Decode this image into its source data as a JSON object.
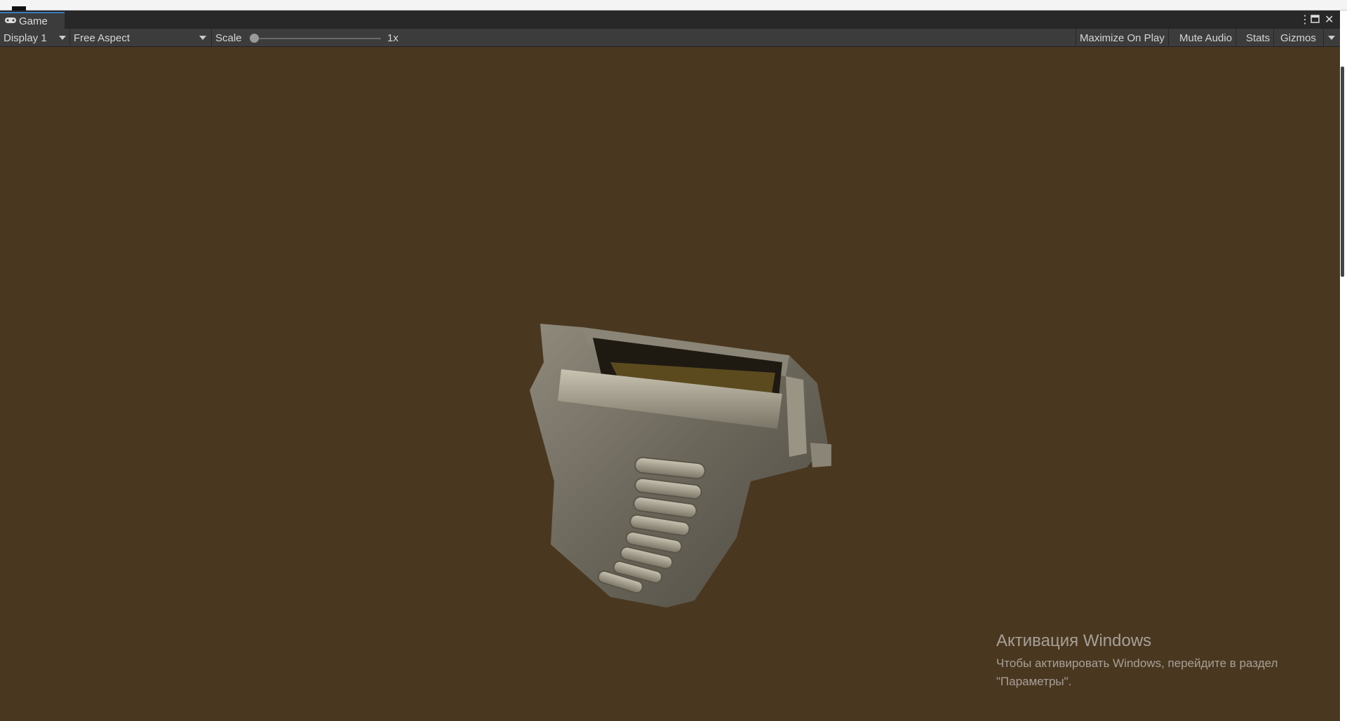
{
  "tab": {
    "label": "Game",
    "icon": "gamepad-icon"
  },
  "toolbar": {
    "display": "Display 1",
    "aspect": "Free Aspect",
    "scale_label": "Scale",
    "scale_value": "1x",
    "scale_fraction": 0,
    "maximize": "Maximize On Play",
    "mute": "Mute Audio",
    "stats": "Stats",
    "gizmos": "Gizmos"
  },
  "watermark": {
    "title": "Активация Windows",
    "line1": "Чтобы активировать Windows, перейдите в раздел",
    "line2": "\"Параметры\"."
  },
  "colors": {
    "background": "#4a3720",
    "accent": "#3a79bb"
  }
}
